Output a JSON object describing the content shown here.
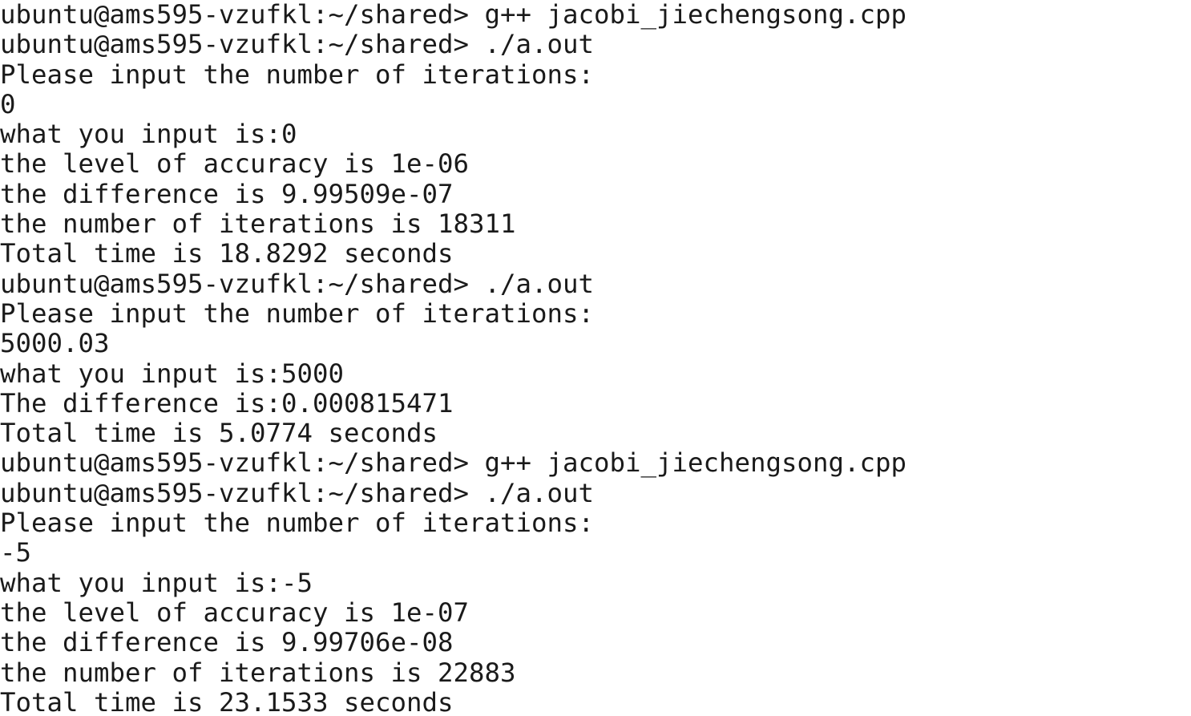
{
  "terminal": {
    "lines": [
      "ubuntu@ams595-vzufkl:~/shared> g++ jacobi_jiechengsong.cpp",
      "ubuntu@ams595-vzufkl:~/shared> ./a.out",
      "Please input the number of iterations:",
      "0",
      "what you input is:0",
      "the level of accuracy is 1e-06",
      "the difference is 9.99509e-07",
      "the number of iterations is 18311",
      "Total time is 18.8292 seconds",
      "ubuntu@ams595-vzufkl:~/shared> ./a.out",
      "Please input the number of iterations:",
      "5000.03",
      "what you input is:5000",
      "The difference is:0.000815471",
      "Total time is 5.0774 seconds",
      "ubuntu@ams595-vzufkl:~/shared> g++ jacobi_jiechengsong.cpp",
      "ubuntu@ams595-vzufkl:~/shared> ./a.out",
      "Please input the number of iterations:",
      "-5",
      "what you input is:-5",
      "the level of accuracy is 1e-07",
      "the difference is 9.99706e-08",
      "the number of iterations is 22883",
      "Total time is 23.1533 seconds"
    ]
  }
}
